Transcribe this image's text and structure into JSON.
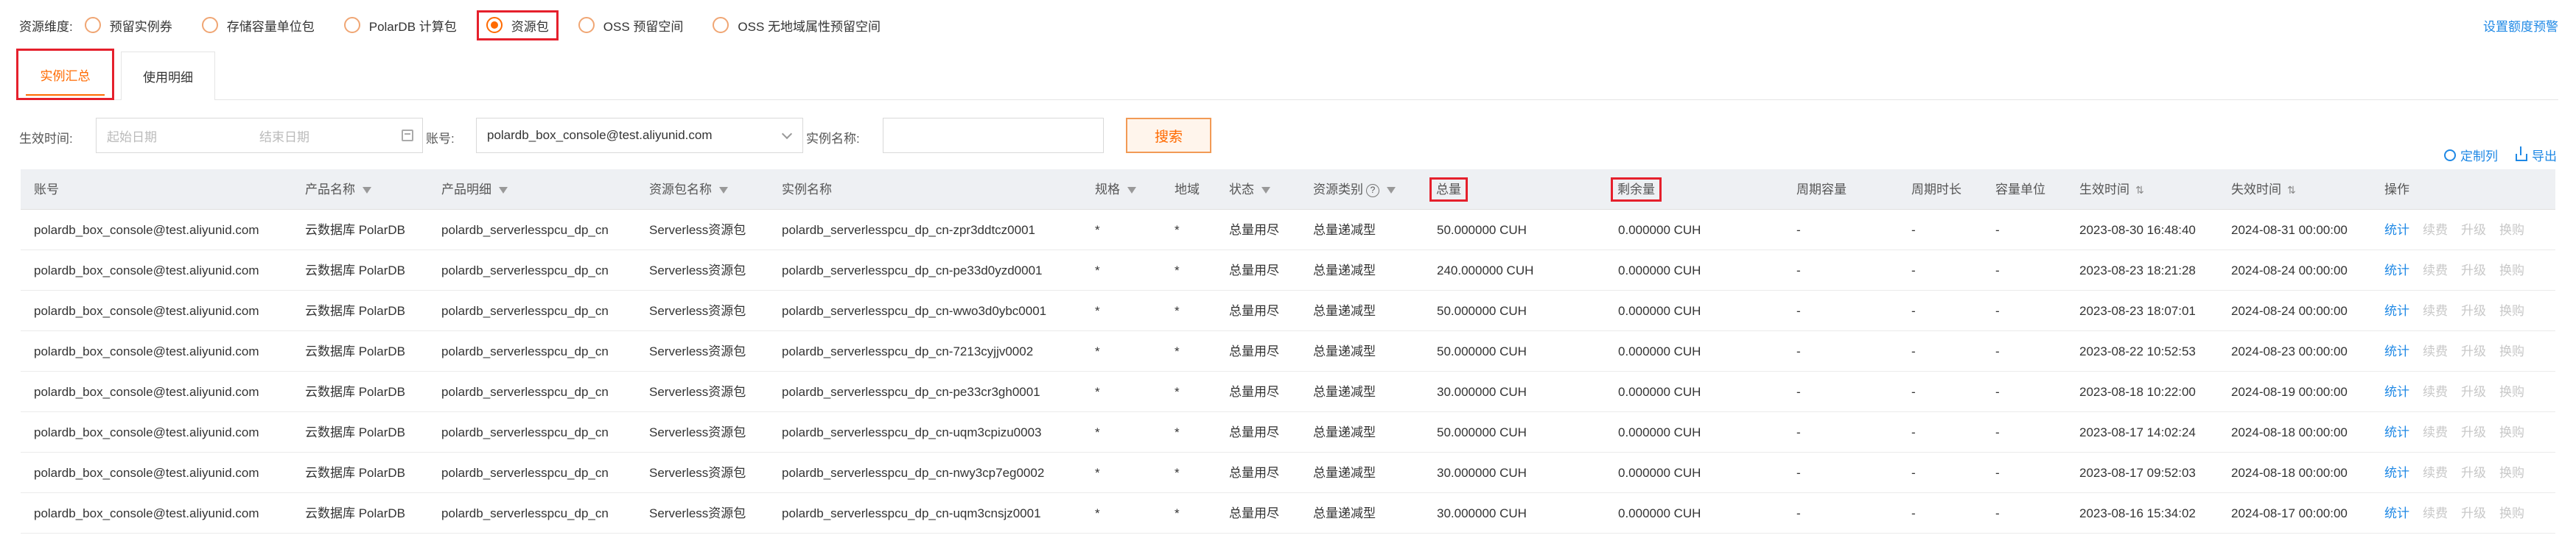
{
  "dimension": {
    "label": "资源维度:",
    "options": [
      {
        "label": "预留实例券",
        "checked": false
      },
      {
        "label": "存储容量单位包",
        "checked": false
      },
      {
        "label": "PolarDB 计算包",
        "checked": false
      },
      {
        "label": "资源包",
        "checked": true
      },
      {
        "label": "OSS 预留空间",
        "checked": false
      },
      {
        "label": "OSS 无地域属性预留空间",
        "checked": false
      }
    ],
    "quota_link": "设置额度预警"
  },
  "tabs": [
    {
      "label": "实例汇总",
      "active": true
    },
    {
      "label": "使用明细",
      "active": false
    }
  ],
  "filters": {
    "time_label": "生效时间:",
    "start_placeholder": "起始日期",
    "end_placeholder": "结束日期",
    "account_label": "账号:",
    "account_value": "polardb_box_console@test.aliyunid.com",
    "name_label": "实例名称:",
    "name_value": "",
    "search_button": "搜索"
  },
  "tools": {
    "customize": "定制列",
    "export": "导出"
  },
  "table": {
    "columns": [
      {
        "key": "account",
        "label": "账号",
        "filter": false
      },
      {
        "key": "product",
        "label": "产品名称",
        "filter": true
      },
      {
        "key": "detail",
        "label": "产品明细",
        "filter": true
      },
      {
        "key": "package",
        "label": "资源包名称",
        "filter": true
      },
      {
        "key": "instance",
        "label": "实例名称",
        "filter": false
      },
      {
        "key": "spec",
        "label": "规格",
        "filter": true
      },
      {
        "key": "region",
        "label": "地域",
        "filter": false
      },
      {
        "key": "status",
        "label": "状态",
        "filter": true
      },
      {
        "key": "rtype",
        "label": "资源类别",
        "filter": true
      },
      {
        "key": "total",
        "label": "总量",
        "filter": false
      },
      {
        "key": "remain",
        "label": "剩余量",
        "filter": false
      },
      {
        "key": "pcap",
        "label": "周期容量",
        "filter": false
      },
      {
        "key": "plen",
        "label": "周期时长",
        "filter": false
      },
      {
        "key": "unit",
        "label": "容量单位",
        "filter": false
      },
      {
        "key": "start",
        "label": "生效时间",
        "filter": false
      },
      {
        "key": "end",
        "label": "失效时间",
        "filter": false
      },
      {
        "key": "ops",
        "label": "操作",
        "filter": false
      }
    ],
    "ops": [
      "统计",
      "续费",
      "升级",
      "换购"
    ],
    "rows": [
      {
        "account": "polardb_box_console@test.aliyunid.com",
        "product": "云数据库 PolarDB",
        "detail": "polardb_serverlesspcu_dp_cn",
        "package": "Serverless资源包",
        "instance": "polardb_serverlesspcu_dp_cn-zpr3ddtcz0001",
        "spec": "*",
        "region": "*",
        "status": "总量用尽",
        "rtype": "总量递减型",
        "total": "50.000000 CUH",
        "remain": "0.000000 CUH",
        "pcap": "-",
        "plen": "-",
        "unit": "-",
        "start": "2023-08-30 16:48:40",
        "end": "2024-08-31 00:00:00"
      },
      {
        "account": "polardb_box_console@test.aliyunid.com",
        "product": "云数据库 PolarDB",
        "detail": "polardb_serverlesspcu_dp_cn",
        "package": "Serverless资源包",
        "instance": "polardb_serverlesspcu_dp_cn-pe33d0yzd0001",
        "spec": "*",
        "region": "*",
        "status": "总量用尽",
        "rtype": "总量递减型",
        "total": "240.000000 CUH",
        "remain": "0.000000 CUH",
        "pcap": "-",
        "plen": "-",
        "unit": "-",
        "start": "2023-08-23 18:21:28",
        "end": "2024-08-24 00:00:00"
      },
      {
        "account": "polardb_box_console@test.aliyunid.com",
        "product": "云数据库 PolarDB",
        "detail": "polardb_serverlesspcu_dp_cn",
        "package": "Serverless资源包",
        "instance": "polardb_serverlesspcu_dp_cn-wwo3d0ybc0001",
        "spec": "*",
        "region": "*",
        "status": "总量用尽",
        "rtype": "总量递减型",
        "total": "50.000000 CUH",
        "remain": "0.000000 CUH",
        "pcap": "-",
        "plen": "-",
        "unit": "-",
        "start": "2023-08-23 18:07:01",
        "end": "2024-08-24 00:00:00"
      },
      {
        "account": "polardb_box_console@test.aliyunid.com",
        "product": "云数据库 PolarDB",
        "detail": "polardb_serverlesspcu_dp_cn",
        "package": "Serverless资源包",
        "instance": "polardb_serverlesspcu_dp_cn-7213cyjjv0002",
        "spec": "*",
        "region": "*",
        "status": "总量用尽",
        "rtype": "总量递减型",
        "total": "50.000000 CUH",
        "remain": "0.000000 CUH",
        "pcap": "-",
        "plen": "-",
        "unit": "-",
        "start": "2023-08-22 10:52:53",
        "end": "2024-08-23 00:00:00"
      },
      {
        "account": "polardb_box_console@test.aliyunid.com",
        "product": "云数据库 PolarDB",
        "detail": "polardb_serverlesspcu_dp_cn",
        "package": "Serverless资源包",
        "instance": "polardb_serverlesspcu_dp_cn-pe33cr3gh0001",
        "spec": "*",
        "region": "*",
        "status": "总量用尽",
        "rtype": "总量递减型",
        "total": "30.000000 CUH",
        "remain": "0.000000 CUH",
        "pcap": "-",
        "plen": "-",
        "unit": "-",
        "start": "2023-08-18 10:22:00",
        "end": "2024-08-19 00:00:00"
      },
      {
        "account": "polardb_box_console@test.aliyunid.com",
        "product": "云数据库 PolarDB",
        "detail": "polardb_serverlesspcu_dp_cn",
        "package": "Serverless资源包",
        "instance": "polardb_serverlesspcu_dp_cn-uqm3cpizu0003",
        "spec": "*",
        "region": "*",
        "status": "总量用尽",
        "rtype": "总量递减型",
        "total": "50.000000 CUH",
        "remain": "0.000000 CUH",
        "pcap": "-",
        "plen": "-",
        "unit": "-",
        "start": "2023-08-17 14:02:24",
        "end": "2024-08-18 00:00:00"
      },
      {
        "account": "polardb_box_console@test.aliyunid.com",
        "product": "云数据库 PolarDB",
        "detail": "polardb_serverlesspcu_dp_cn",
        "package": "Serverless资源包",
        "instance": "polardb_serverlesspcu_dp_cn-nwy3cp7eg0002",
        "spec": "*",
        "region": "*",
        "status": "总量用尽",
        "rtype": "总量递减型",
        "total": "30.000000 CUH",
        "remain": "0.000000 CUH",
        "pcap": "-",
        "plen": "-",
        "unit": "-",
        "start": "2023-08-17 09:52:03",
        "end": "2024-08-18 00:00:00"
      },
      {
        "account": "polardb_box_console@test.aliyunid.com",
        "product": "云数据库 PolarDB",
        "detail": "polardb_serverlesspcu_dp_cn",
        "package": "Serverless资源包",
        "instance": "polardb_serverlesspcu_dp_cn-uqm3cnsjz0001",
        "spec": "*",
        "region": "*",
        "status": "总量用尽",
        "rtype": "总量递减型",
        "total": "30.000000 CUH",
        "remain": "0.000000 CUH",
        "pcap": "-",
        "plen": "-",
        "unit": "-",
        "start": "2023-08-16 15:34:02",
        "end": "2024-08-17 00:00:00"
      }
    ]
  }
}
